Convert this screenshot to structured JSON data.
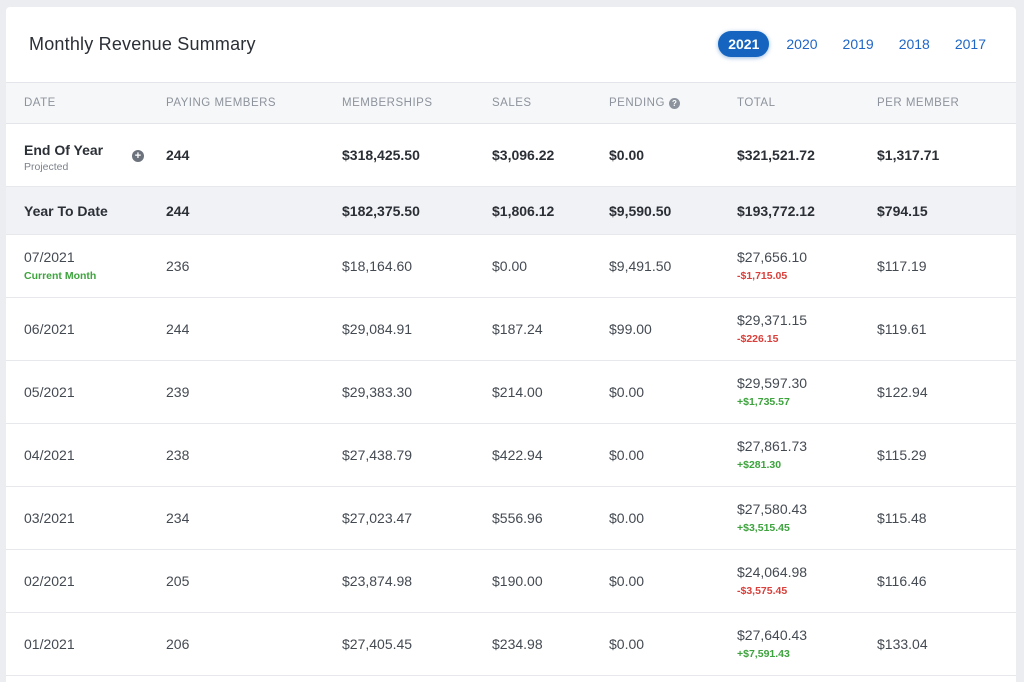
{
  "header": {
    "title": "Monthly Revenue Summary",
    "years": [
      "2021",
      "2020",
      "2019",
      "2018",
      "2017"
    ],
    "active_year": "2021"
  },
  "columns": {
    "date": "DATE",
    "paying_members": "PAYING MEMBERS",
    "memberships": "MEMBERSHIPS",
    "sales": "SALES",
    "pending": "PENDING",
    "total": "TOTAL",
    "per_member": "PER MEMBER"
  },
  "end_of_year": {
    "label": "End Of Year",
    "sublabel": "Projected",
    "paying_members": "244",
    "memberships": "$318,425.50",
    "sales": "$3,096.22",
    "pending": "$0.00",
    "total": "$321,521.72",
    "per_member": "$1,317.71"
  },
  "year_to_date": {
    "label": "Year To Date",
    "paying_members": "244",
    "memberships": "$182,375.50",
    "sales": "$1,806.12",
    "pending": "$9,590.50",
    "total": "$193,772.12",
    "per_member": "$794.15"
  },
  "months": [
    {
      "date": "07/2021",
      "note": "Current Month",
      "paying_members": "236",
      "memberships": "$18,164.60",
      "sales": "$0.00",
      "pending": "$9,491.50",
      "total": "$27,656.10",
      "diff": "-$1,715.05",
      "per_member": "$117.19"
    },
    {
      "date": "06/2021",
      "note": "",
      "paying_members": "244",
      "memberships": "$29,084.91",
      "sales": "$187.24",
      "pending": "$99.00",
      "total": "$29,371.15",
      "diff": "-$226.15",
      "per_member": "$119.61"
    },
    {
      "date": "05/2021",
      "note": "",
      "paying_members": "239",
      "memberships": "$29,383.30",
      "sales": "$214.00",
      "pending": "$0.00",
      "total": "$29,597.30",
      "diff": "+$1,735.57",
      "per_member": "$122.94"
    },
    {
      "date": "04/2021",
      "note": "",
      "paying_members": "238",
      "memberships": "$27,438.79",
      "sales": "$422.94",
      "pending": "$0.00",
      "total": "$27,861.73",
      "diff": "+$281.30",
      "per_member": "$115.29"
    },
    {
      "date": "03/2021",
      "note": "",
      "paying_members": "234",
      "memberships": "$27,023.47",
      "sales": "$556.96",
      "pending": "$0.00",
      "total": "$27,580.43",
      "diff": "+$3,515.45",
      "per_member": "$115.48"
    },
    {
      "date": "02/2021",
      "note": "",
      "paying_members": "205",
      "memberships": "$23,874.98",
      "sales": "$190.00",
      "pending": "$0.00",
      "total": "$24,064.98",
      "diff": "-$3,575.45",
      "per_member": "$116.46"
    },
    {
      "date": "01/2021",
      "note": "",
      "paying_members": "206",
      "memberships": "$27,405.45",
      "sales": "$234.98",
      "pending": "$0.00",
      "total": "$27,640.43",
      "diff": "+$7,591.43",
      "per_member": "$133.04"
    }
  ],
  "colors": {
    "accent": "#1565c0",
    "negative": "#d9403b",
    "positive": "#3da33d"
  },
  "icons": {
    "pending_help": "question-circle-icon",
    "expand_projection": "plus-circle-icon"
  }
}
